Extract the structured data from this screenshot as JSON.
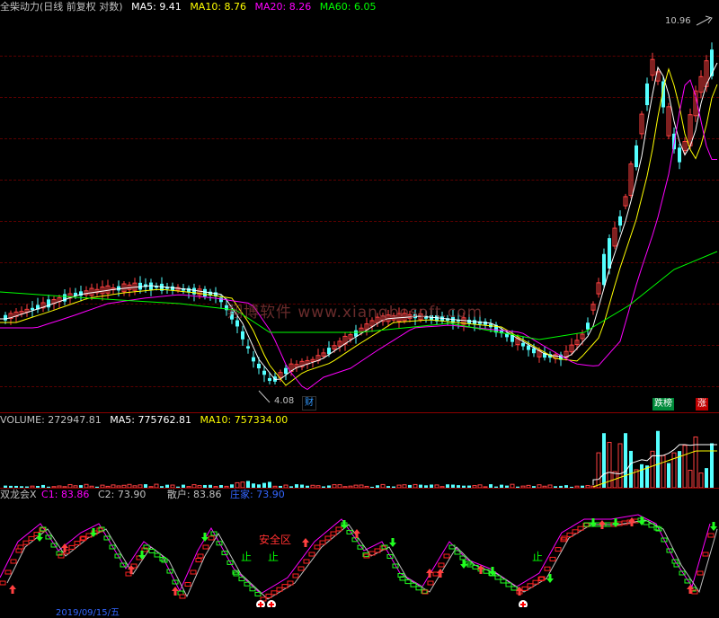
{
  "header": {
    "stock": "全柴动力(日线 前复权 对数)",
    "ma5": {
      "label": "MA5:",
      "value": "9.41",
      "color": "#ffffff"
    },
    "ma10": {
      "label": "MA10:",
      "value": "8.76",
      "color": "#ffff00"
    },
    "ma20": {
      "label": "MA20:",
      "value": "8.26",
      "color": "#ff00ff"
    },
    "ma60": {
      "label": "MA60:",
      "value": "6.05",
      "color": "#00ff00"
    }
  },
  "price_annotations": {
    "high": "10.96",
    "low": "4.08",
    "cai_tag": "财",
    "dieb_tag": "跌榜",
    "zhang_tag": "涨"
  },
  "watermark": "翔博软件  www.xiangbosoft.com",
  "volume_header": {
    "volume": {
      "label": "VOLUME:",
      "value": "272947.81"
    },
    "ma5": {
      "label": "MA5:",
      "value": "775762.81"
    },
    "ma10": {
      "label": "MA10:",
      "value": "757334.00"
    }
  },
  "indicator_header": {
    "name": "双龙会X",
    "c1": {
      "label": "C1:",
      "value": "83.86",
      "color": "#ff00ff"
    },
    "c2": {
      "label": "C2:",
      "value": "73.90",
      "color": "#c0c0c0"
    },
    "sanhu": {
      "label": "散户:",
      "value": "83.86"
    },
    "zhuangjia": {
      "label": "庄家:",
      "value": "73.90",
      "color": "#3366ff"
    }
  },
  "indicator_annotations": {
    "anquan": "安全区",
    "zhi1": "止",
    "zhi2": "止",
    "zhi3": "止"
  },
  "footer": {
    "date": "2019/09/15/五"
  },
  "colors": {
    "up": "#ff4040",
    "down": "#54ffff",
    "ma5": "#ffffff",
    "ma10": "#ffff00",
    "ma20": "#ff00ff",
    "ma60": "#00ff00",
    "grid": "#5a0000"
  }
}
